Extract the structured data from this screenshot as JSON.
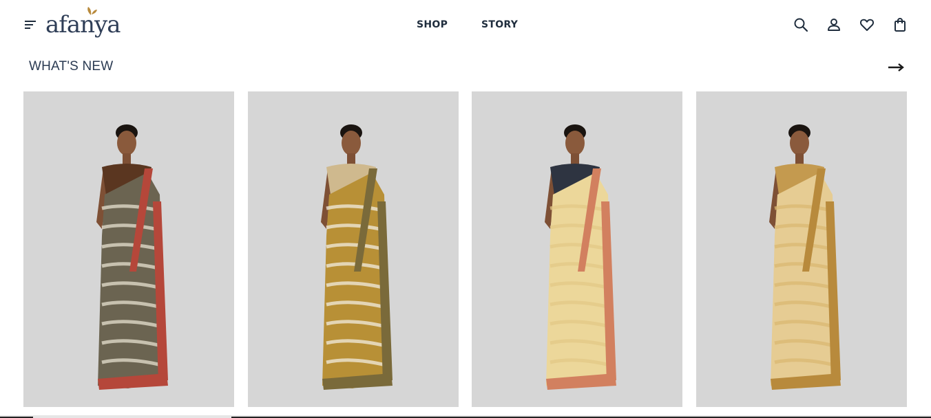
{
  "header": {
    "logo_text": "afanya",
    "nav": [
      {
        "label": "SHOP"
      },
      {
        "label": "STORY"
      }
    ],
    "icons": [
      "menu-icon",
      "search-icon",
      "user-icon",
      "heart-icon",
      "bag-icon"
    ]
  },
  "section": {
    "title": "WHAT'S NEW",
    "arrow_icon": "arrow-right-icon"
  },
  "products": [
    {
      "name": "product-1",
      "saree_colors": {
        "body": "#6b6451",
        "pattern": "#e6e0cf",
        "border": "#b5473a",
        "blouse": "#5a3620"
      }
    },
    {
      "name": "product-2",
      "saree_colors": {
        "body": "#b89036",
        "pattern": "#f1ece0",
        "border": "#7a6a3a",
        "blouse": "#cfb98e"
      }
    },
    {
      "name": "product-3",
      "saree_colors": {
        "body": "#ecd79a",
        "pattern": "#e3c885",
        "border": "#d2805f",
        "blouse": "#2e3441"
      }
    },
    {
      "name": "product-4",
      "saree_colors": {
        "body": "#e6cc93",
        "pattern": "#d9b871",
        "border": "#b88a3c",
        "blouse": "#c49a4f"
      }
    }
  ],
  "colors": {
    "text": "#1f2d3d",
    "card_bg": "#d6d6d6",
    "logo": "#2f3e57",
    "logo_leaf": "#b88a3c"
  }
}
